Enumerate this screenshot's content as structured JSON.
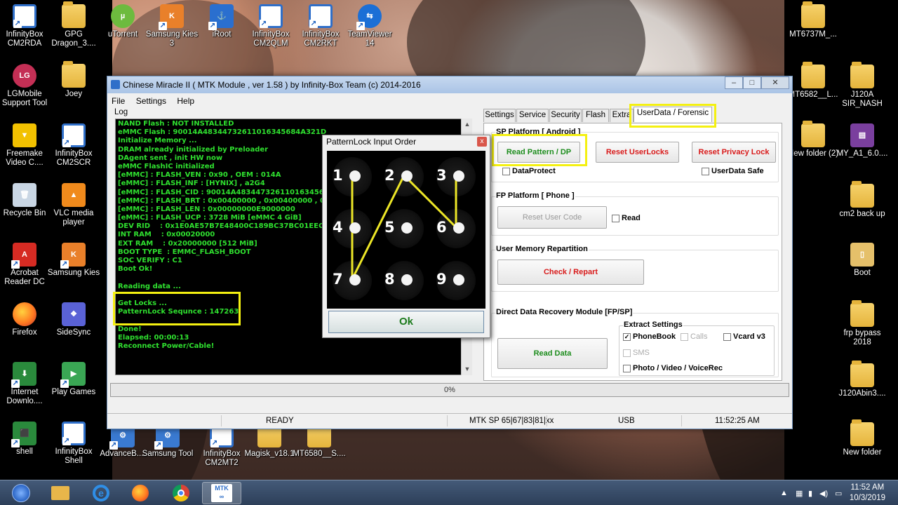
{
  "desktop": {
    "left_icons": [
      {
        "label": "InfinityBox CM2RDA",
        "badge": "RDA"
      },
      {
        "label": "GPG Dragon_3...."
      },
      {
        "label": "LGMobile Support Tool"
      },
      {
        "label": "Joey"
      },
      {
        "label": "Freemake Video C...."
      },
      {
        "label": "InfinityBox CM2SCR",
        "badge": "SCR"
      },
      {
        "label": "Recycle Bin"
      },
      {
        "label": "VLC media player"
      },
      {
        "label": "Acrobat Reader DC"
      },
      {
        "label": "Samsung Kies"
      },
      {
        "label": "Firefox"
      },
      {
        "label": "SideSync"
      },
      {
        "label": "Internet Downlo...."
      },
      {
        "label": "Play Games"
      },
      {
        "label": "shell"
      },
      {
        "label": "InfinityBox Shell"
      }
    ],
    "top_icons": [
      {
        "label": "uTorrent"
      },
      {
        "label": "Samsung Kies 3",
        "badge": "K3"
      },
      {
        "label": "iRoot"
      },
      {
        "label": "InfinityBox CM2QLM",
        "badge": "QLM"
      },
      {
        "label": "InfinityBox CM2RKT",
        "badge": "RKT"
      },
      {
        "label": "TeamViewer 14"
      }
    ],
    "bottom_icons": [
      {
        "label": "AdvanceB...."
      },
      {
        "label": "Samsung Tool"
      },
      {
        "label": "InfinityBox CM2MT2"
      },
      {
        "label": "Magisk_v18.1"
      },
      {
        "label": "MT6580__S...."
      }
    ],
    "right_icons": [
      {
        "label": "MT6737M_..."
      },
      {
        "label": "MT6582__L..."
      },
      {
        "label": "J120A SIR_NASH"
      },
      {
        "label": "New folder (2)"
      },
      {
        "label": "MY_A1_6.0...."
      },
      {
        "label": "cm2 back up"
      },
      {
        "label": "Boot"
      },
      {
        "label": "frp bypass 2018"
      },
      {
        "label": "J120Abin3...."
      },
      {
        "label": "New folder"
      }
    ]
  },
  "window": {
    "title": "Chinese Miracle II ( MTK Module , ver 1.58 ) by Infinity-Box Team (c) 2014-2016",
    "menu": [
      "File",
      "Settings",
      "Help"
    ],
    "log_label": "Log",
    "log_lines": [
      "NAND Flash : NOT INSTALLED",
      "eMMC Flash : 90014A48344732611016345684A321D",
      "Initialize Memory ...",
      "DRAM already initialized by Preloader",
      "DAgent sent , init HW now",
      "eMMC FlashIC initialized",
      "[eMMC] : FLASH_VEN : 0x90 , OEM : 014A",
      "[eMMC] : FLASH_INF : [HYNIX] , a2G4",
      "[eMMC] : FLASH_CID : 90014A48344732611016345684",
      "[eMMC] : FLASH_BRT : 0x00400000 , 0x00400000 , 0x00",
      "[eMMC] : FLASH_LEN : 0x00000000E9000000",
      "[eMMC] : FLASH_UCP : 3728 MiB [eMMC 4 GiB]",
      "DEV RID    : 0x1E0AE57B7E48400C189BC37BC01EEC57",
      "INT RAM    : 0x00020000",
      "EXT RAM    : 0x20000000 [512 MiB]",
      "BOOT TYPE  : EMMC_FLASH_BOOT",
      "SOC VERIFY : C1",
      "Boot Ok!",
      "",
      "Reading data ...",
      "",
      "Get Locks ...",
      "PatternLock Sequnce : 147263",
      "",
      "Done!",
      "Elapsed: 00:00:13",
      "Reconnect Power/Cable!"
    ],
    "tabs": [
      "Settings",
      "Service",
      "Security",
      "Flash",
      "Extra",
      "UserData / Forensic"
    ],
    "active_tab": "UserData / Forensic",
    "sp_platform": {
      "label": "SP Platform [ Android ]",
      "read_pattern": "Read Pattern / DP",
      "reset_userlocks": "Reset UserLocks",
      "reset_privacy": "Reset Privacy Lock",
      "dataprotect": "DataProtect",
      "userdata_safe": "UserData Safe"
    },
    "fp_platform": {
      "label": "FP Platform [ Phone ]",
      "reset_user_code": "Reset User Code",
      "read": "Read"
    },
    "user_memory": {
      "label": "User Memory Repartition",
      "check_repart": "Check / Repart"
    },
    "ddr": {
      "label": "Direct Data Recovery Module  [FP/SP]",
      "read_data": "Read Data",
      "extract_settings": "Extract Settings",
      "phonebook": "PhoneBook",
      "calls": "Calls",
      "vcard": "Vcard v3",
      "sms": "SMS",
      "photo": "Photo / Video / VoiceRec"
    },
    "progress_text": "0%",
    "status": {
      "ready": "READY",
      "mtk": "MTK SP 65|67|83|81|xx",
      "usb": "USB",
      "time": "11:52:25 AM"
    }
  },
  "pattern_dialog": {
    "title": "PatternLock Input Order",
    "close": "x",
    "numbers": [
      "1",
      "2",
      "3",
      "4",
      "5",
      "6",
      "7",
      "8",
      "9"
    ],
    "sequence": [
      1,
      4,
      7,
      2,
      6,
      3
    ],
    "ok": "Ok"
  },
  "taskbar": {
    "clock_time": "11:52 AM",
    "clock_date": "10/3/2019",
    "mtk_label": "MTK"
  },
  "colors": {
    "log_text": "#2fe02f",
    "highlight": "#f4f011",
    "pattern_line": "#ece627",
    "red_button": "#d81a1a",
    "green_button": "#1c8c1c"
  }
}
